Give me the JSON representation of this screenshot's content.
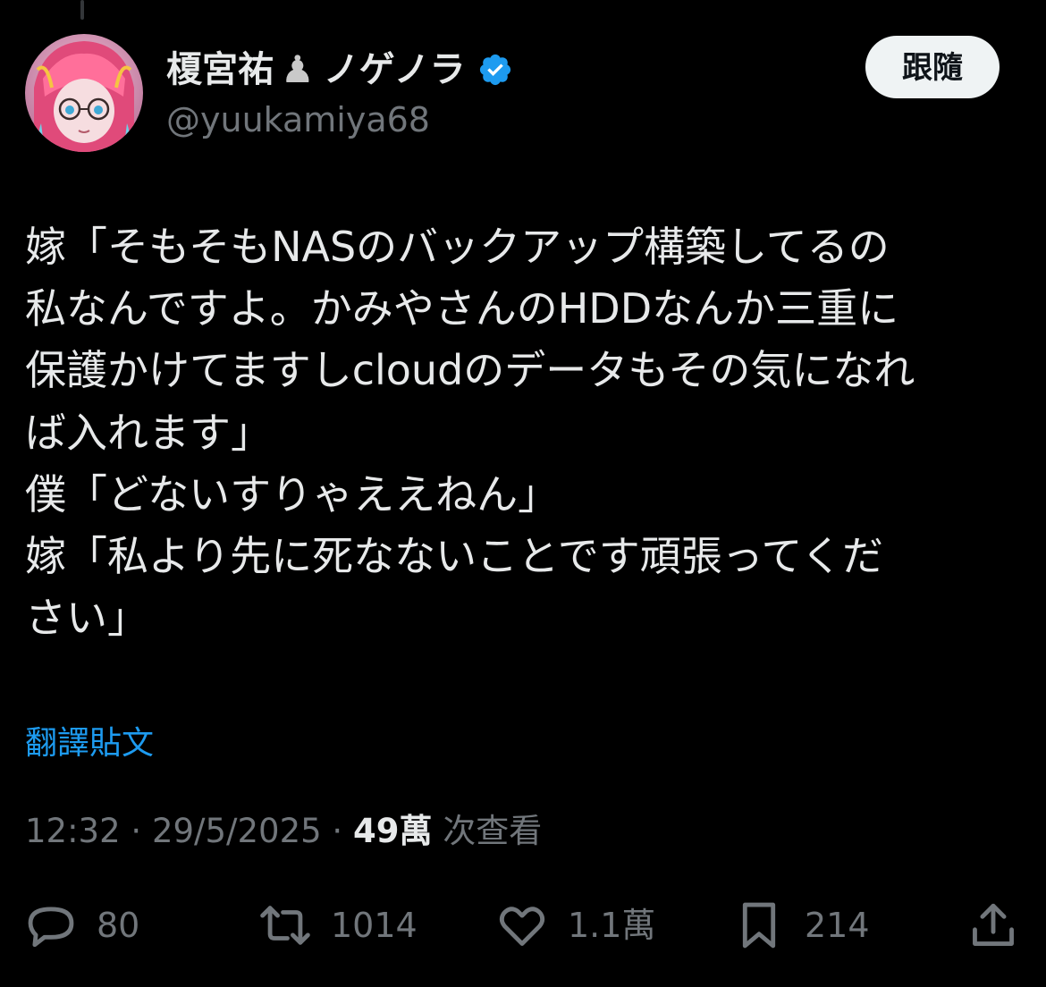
{
  "author": {
    "display_name": "榎宮祐",
    "display_name_suffix": "ノゲノラ",
    "handle": "@yuukamiya68",
    "verified": true,
    "verified_color": "#1d9bf0"
  },
  "follow_button": {
    "label": "跟隨"
  },
  "tweet": {
    "text": "嫁「そもそもNASのバックアップ構築してるの\n私なんですよ。かみやさんのHDDなんか三重に\n保護かけてますしcloudのデータもその気になれ\nば入れます」\n僕「どないすりゃええねん」\n嫁「私より先に死なないことです頑張ってくだ\nさい」",
    "translate_label": "翻譯貼文"
  },
  "meta": {
    "time": "12:32",
    "separator": "·",
    "date": "29/5/2025",
    "views_count": "49萬",
    "views_label": "次查看"
  },
  "actions": {
    "replies": "80",
    "reposts": "1014",
    "likes": "1.1萬",
    "bookmarks": "214"
  },
  "colors": {
    "background": "#000000",
    "text": "#e7e9ea",
    "secondary": "#71767b",
    "accent": "#1d9bf0"
  }
}
